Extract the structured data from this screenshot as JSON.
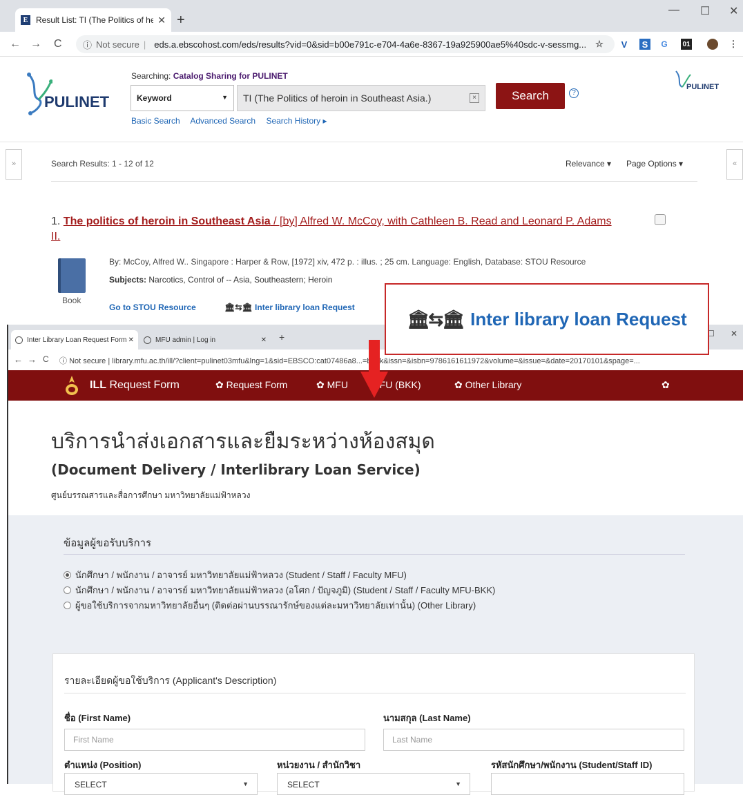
{
  "window1": {
    "tab_title": "Result List: TI (The Politics of hero",
    "favicon_letter": "E",
    "address_security": "Not secure",
    "address_url": "eds.a.ebscohost.com/eds/results?vid=0&sid=b00e791c-e704-4a6e-8367-19a925900ae5%40sdc-v-sessmg...",
    "logo_text": "PULINET",
    "searching_label": "Searching:",
    "searching_target": "Catalog Sharing for PULINET",
    "field_select": "Keyword",
    "query": "TI (The Politics of heroin in Southeast Asia.)",
    "search_button": "Search",
    "help": "?",
    "links": [
      "Basic Search",
      "Advanced Search",
      "Search History ▸"
    ],
    "results_count": "Search Results: 1 - 12 of 12",
    "sort": "Relevance ▾",
    "page_options": "Page Options ▾",
    "result": {
      "number": "1.",
      "title": "The politics of heroin in Southeast Asia",
      "authors": " / [by] Alfred W. McCoy, with Cathleen B. Read and Leonard P. Adams II.",
      "byline": "By: McCoy, Alfred W.. Singapore : Harper & Row, [1972] xiv, 472 p. : illus. ; 25 cm. Language: English, Database: STOU Resource",
      "subjects_label": "Subjects:",
      "subjects": "Narcotics, Control of -- Asia, Southeastern; Heroin",
      "type": "Book",
      "go_link": "Go to STOU Resource",
      "ill_link": "Inter library loan Request"
    },
    "extensions": [
      "V",
      "S",
      "01"
    ]
  },
  "callout": {
    "text": "Inter library loan Request",
    "border_color": "#c62828"
  },
  "window2": {
    "tabs": [
      "Inter Library Loan Request Form",
      "MFU admin | Log in"
    ],
    "address_security": "Not secure",
    "address_url": "library.mfu.ac.th/ill/?client=pulinet03mfu&lng=1&sid=EBSCO:cat07486a8...=book&issn=&isbn=9786161611972&volume=&issue=&date=20170101&spage=...",
    "nav": {
      "brand_bold": "ILL",
      "brand_rest": " Request Form",
      "items": [
        "Request Form",
        "MFU",
        "MFU (BKK)",
        "Other Library"
      ],
      "bg": "#800f0f"
    },
    "heading_th": "บริการนำส่งเอกสารและยืมระหว่างห้องสมุด",
    "heading_en": "(Document Delivery / Interlibrary Loan Service)",
    "org": "ศูนย์บรรณสารและสื่อการศึกษา มหาวิทยาลัยแม่ฟ้าหลวง",
    "section_title": "ข้อมูลผู้ขอรับบริการ",
    "radios": [
      "นักศึกษา / พนักงาน / อาจารย์ มหาวิทยาลัยแม่ฟ้าหลวง (Student / Staff / Faculty MFU)",
      "นักศึกษา / พนักงาน / อาจารย์ มหาวิทยาลัยแม่ฟ้าหลวง (อโศก / ปัญจภูมิ) (Student / Staff / Faculty MFU-BKK)",
      "ผู้ขอใช้บริการจากมหาวิทยาลัยอื่นๆ (ติดต่อผ่านบรรณารักษ์ของแต่ละมหาวิทยาลัยเท่านั้น) (Other Library)"
    ],
    "applicant_title": "รายละเอียดผู้ขอใช้บริการ (Applicant's Description)",
    "first_name_label": "ชื่อ (First Name)",
    "first_name_placeholder": "First Name",
    "last_name_label": "นามสกุล (Last Name)",
    "last_name_placeholder": "Last Name",
    "position_label": "ตำแหน่ง (Position)",
    "position_value": "SELECT",
    "dept_label": "หน่วยงาน / สำนักวิชา",
    "dept_value": "SELECT",
    "id_label": "รหัสนักศึกษา/พนักงาน (Student/Staff ID)"
  }
}
